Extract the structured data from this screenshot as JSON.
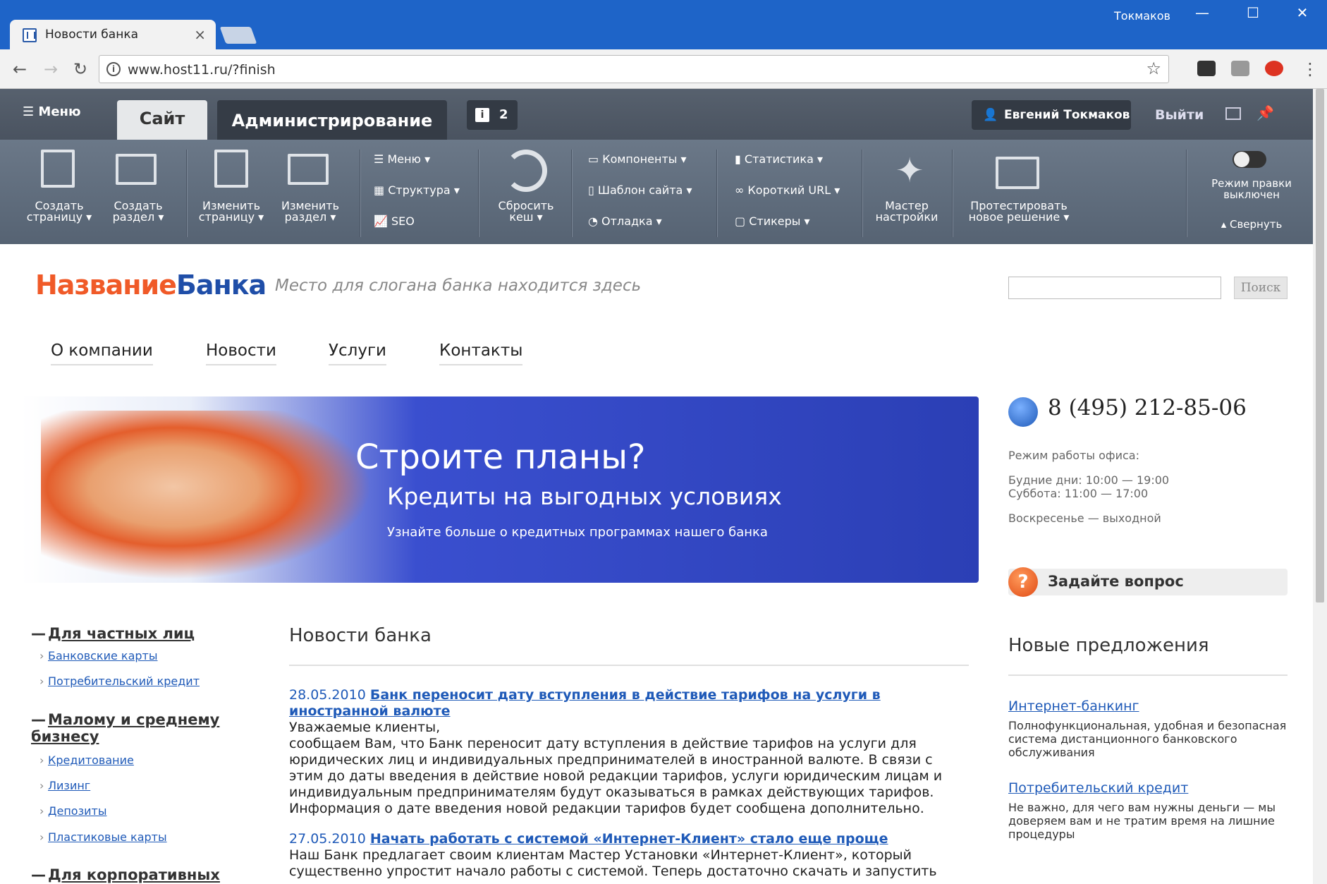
{
  "browser": {
    "tab_title": "Новости банка",
    "tab_close": "×",
    "user": "Токмаков",
    "url": "www.host11.ru/?finish",
    "minimize": "—",
    "maximize": "☐",
    "close": "✕",
    "back": "←",
    "forward": "→",
    "reload": "↻",
    "star": "☆",
    "more": "⋮"
  },
  "panel": {
    "menu": "Меню",
    "tab_site": "Сайт",
    "tab_admin": "Администрирование",
    "notifications": "2",
    "user_name": "Евгений Токмаков",
    "logout": "Выйти",
    "create_page": "Создать\nстраницу ▾",
    "create_section": "Создать\nраздел ▾",
    "edit_page": "Изменить\nстраницу ▾",
    "edit_section": "Изменить\nраздел ▾",
    "menu_item": "Меню ▾",
    "structure": "Структура ▾",
    "seo": "SEO",
    "reset_cache": "Сбросить\nкеш ▾",
    "components": "Компоненты ▾",
    "site_template": "Шаблон сайта ▾",
    "debug": "Отладка ▾",
    "statistics": "Статистика ▾",
    "short_url": "Короткий URL ▾",
    "stickers": "Стикеры ▾",
    "wizard": "Мастер\nнастройки",
    "test_solution": "Протестировать\nновое решение ▾",
    "edit_mode": "Режим правки\nвыключен",
    "collapse": "▴ Свернуть"
  },
  "site": {
    "logo_a": "Название",
    "logo_b": "Банка",
    "slogan": "Место для слогана банка находится здесь",
    "search_button": "Поиск",
    "nav": [
      "О компании",
      "Новости",
      "Услуги",
      "Контакты"
    ],
    "banner_title": "Строите планы?",
    "banner_subtitle": "Кредиты на выгодных условиях",
    "banner_text": "Узнайте больше о кредитных программах нашего банка",
    "phone": "8 (495) 212-85-06",
    "hours_title": "Режим работы офиса:",
    "hours_weekdays": "Будние дни: 10:00 — 19:00",
    "hours_saturday": "Суббота: 11:00 — 17:00",
    "hours_sunday": "Воскресенье — выходной",
    "ask": "Задайте вопрос",
    "new_offers": "Новые предложения",
    "offers": [
      {
        "title": "Интернет-банкинг",
        "text": "Полнофункциональная, удобная и безопасная система дистанционного банковского обслуживания"
      },
      {
        "title": "Потребительский кредит",
        "text": "Не важно, для чего вам нужны деньги — мы доверяем вам и не тратим время на лишние процедуры"
      }
    ],
    "left_nav": {
      "private": "Для частных лиц",
      "private_items": [
        "Банковские карты",
        "Потребительский кредит"
      ],
      "smb": "Малому и среднему бизнесу",
      "smb_items": [
        "Кредитование",
        "Лизинг",
        "Депозиты",
        "Пластиковые карты"
      ],
      "corporate": "Для корпоративных"
    },
    "news_title": "Новости банка",
    "news": [
      {
        "date": "28.05.2010",
        "title": "Банк переносит дату вступления в действие тарифов на услуги в иностранной валюте",
        "text": "Уважаемые клиенты,\nсообщаем Вам, что Банк переносит дату вступления в действие тарифов на услуги для юридических лиц и индивидуальных предпринимателей в иностранной валюте. В связи с этим до даты введения в действие новой редакции тарифов, услуги юридическим лицам и индивидуальным предпринимателям будут оказываться в рамках действующих тарифов. Информация о дате введения новой редакции тарифов будет сообщена дополнительно."
      },
      {
        "date": "27.05.2010",
        "title": "Начать работать с системой «Интернет-Клиент» стало еще проще",
        "text": "Наш Банк предлагает своим клиентам Мастер Установки «Интернет-Клиент», который существенно упростит начало работы с системой. Теперь достаточно скачать и запустить"
      }
    ]
  },
  "colors": {
    "titlebar": "#1e64c8",
    "logo_orange": "#f05a28",
    "logo_blue": "#1f4ea8",
    "link": "#1f5ab8",
    "banner": "#2b3fb5"
  }
}
